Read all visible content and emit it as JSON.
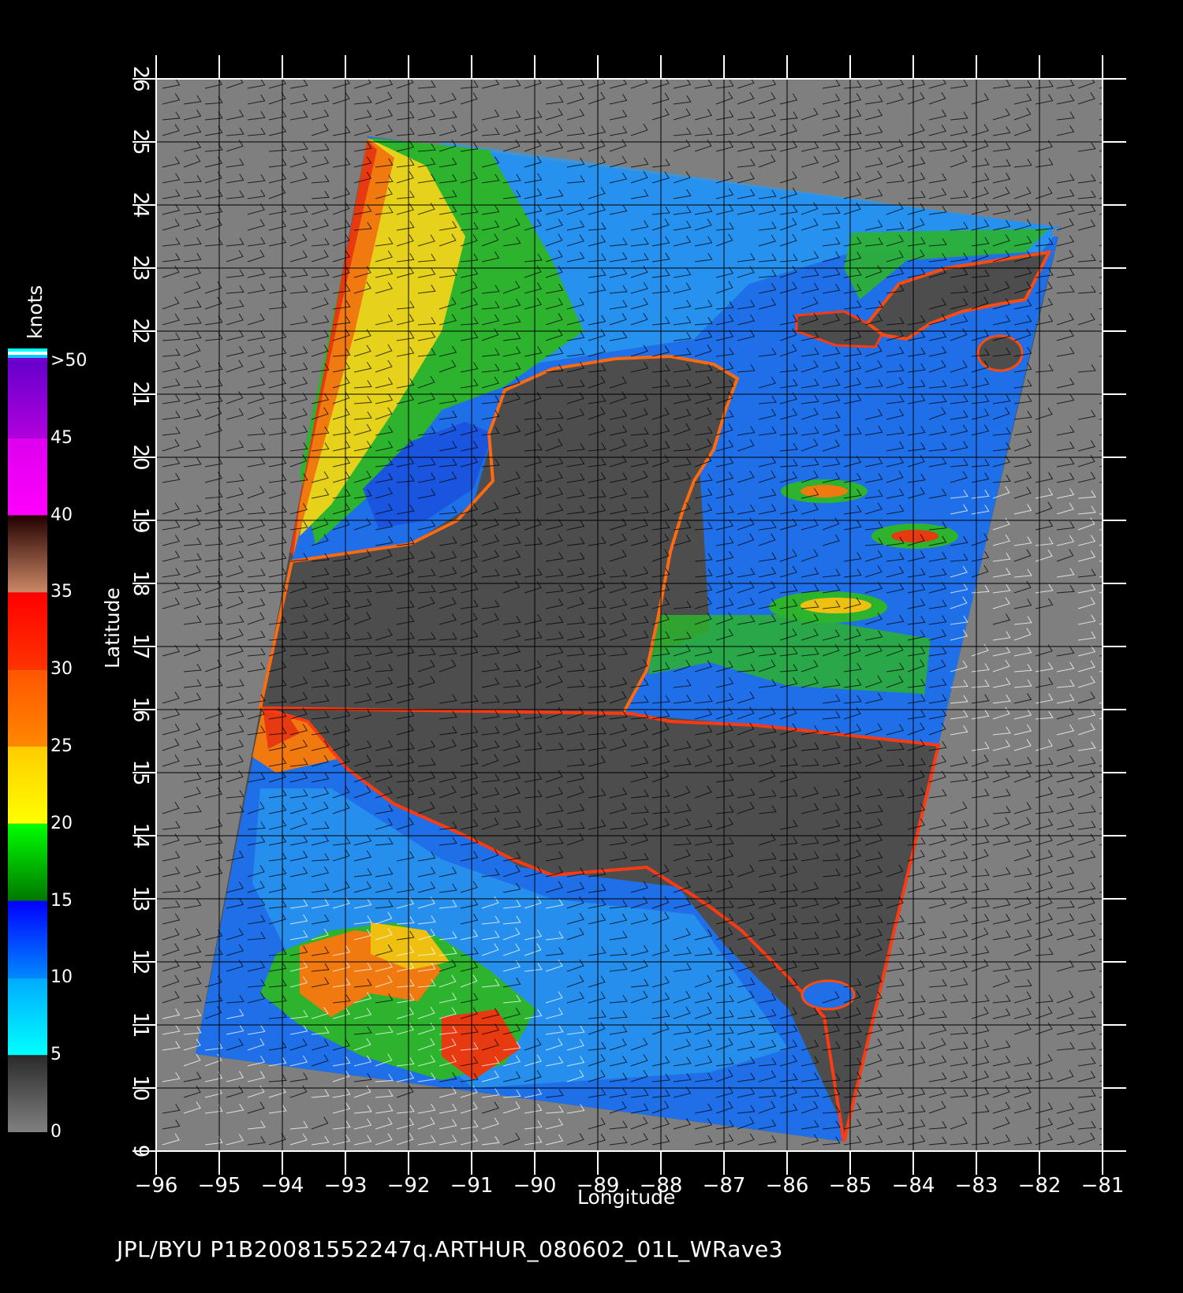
{
  "map": {
    "footer": "JPL/BYU  P1B20081552247q.ARTHUR_080602_01L_WRave3",
    "x_axis_title": "Longitude",
    "y_axis_title": "Latitude",
    "x_ticks": [
      "-96",
      "-95",
      "-94",
      "-93",
      "-92",
      "-91",
      "-90",
      "-89",
      "-88",
      "-87",
      "-86",
      "-85",
      "-84",
      "-83",
      "-82",
      "-81"
    ],
    "y_ticks": [
      "9",
      "10",
      "11",
      "12",
      "13",
      "14",
      "15",
      "16",
      "17",
      "18",
      "19",
      "20",
      "21",
      "22",
      "23",
      "24",
      "25",
      "26"
    ],
    "lon_range": [
      -96,
      -81
    ],
    "lat_range": [
      9,
      26
    ],
    "colors": {
      "no_data": "#7f7f7f",
      "land": "#4d4d4d",
      "background": "#000000",
      "grid": "#000000"
    }
  },
  "colorbar": {
    "unit": "knots",
    "labels": [
      "0",
      "5",
      "10",
      "15",
      "20",
      "25",
      "30",
      "35",
      "40",
      "45",
      ">50"
    ],
    "segments": [
      {
        "from": 0,
        "to": 5,
        "colors": [
          "#808080",
          "#2a2a2a"
        ]
      },
      {
        "from": 5,
        "to": 10,
        "colors": [
          "#00ffff",
          "#00aaff"
        ]
      },
      {
        "from": 10,
        "to": 15,
        "colors": [
          "#0088ff",
          "#0000ff"
        ]
      },
      {
        "from": 15,
        "to": 20,
        "colors": [
          "#007700",
          "#00ff00"
        ]
      },
      {
        "from": 20,
        "to": 25,
        "colors": [
          "#ffff00",
          "#ffcc00"
        ]
      },
      {
        "from": 25,
        "to": 30,
        "colors": [
          "#ff8800",
          "#ff5500"
        ]
      },
      {
        "from": 30,
        "to": 35,
        "colors": [
          "#ff3300",
          "#ff0000"
        ]
      },
      {
        "from": 35,
        "to": 40,
        "colors": [
          "#cc8866",
          "#220000"
        ]
      },
      {
        "from": 40,
        "to": 45,
        "colors": [
          "#ff00ff",
          "#dd00ee"
        ]
      },
      {
        "from": 45,
        "to": 50,
        "colors": [
          "#b000dd",
          "#6600cc"
        ]
      }
    ]
  }
}
